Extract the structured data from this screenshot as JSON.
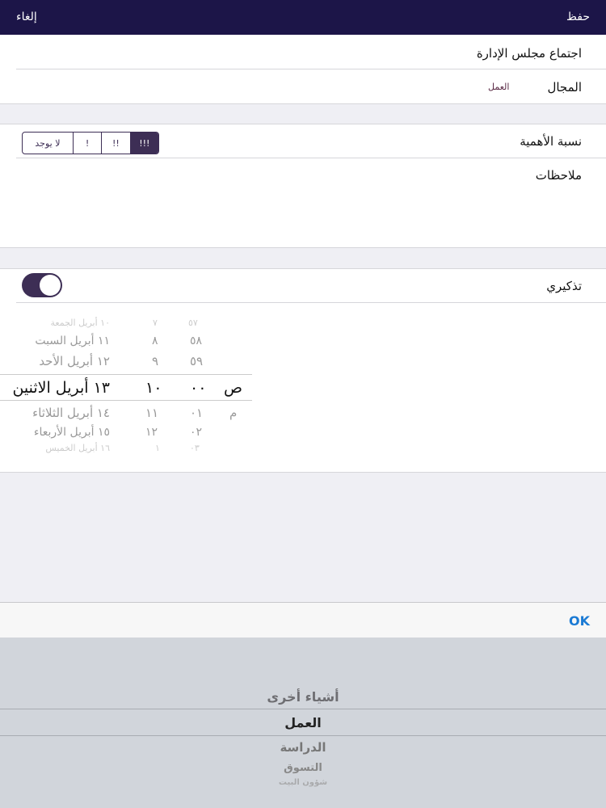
{
  "nav": {
    "save": "حفظ",
    "cancel": "إلغاء"
  },
  "form": {
    "title": "اجتماع مجلس الإدارة",
    "category_label": "المجال",
    "category_value": "العمل",
    "priority_label": "نسبة الأهمية",
    "priority_options": [
      "لا يوجد",
      "!",
      "!!",
      "!!!"
    ],
    "priority_selected": "!!!",
    "notes_label": "ملاحظات",
    "reminder_label": "تذكيري",
    "reminder_on": true
  },
  "date_picker": {
    "dates": [
      "١٠ أبريل الجمعة",
      "١١ أبريل السبت",
      "١٢ أبريل الأحد",
      "١٣ أبريل الاثنين",
      "١٤ أبريل الثلاثاء",
      "١٥ أبريل الأربعاء",
      "١٦ أبريل الخميس"
    ],
    "hours": [
      "٧",
      "٨",
      "٩",
      "١٠",
      "١١",
      "١٢",
      "١"
    ],
    "minutes": [
      "٥٧",
      "٥٨",
      "٥٩",
      "٠٠",
      "٠١",
      "٠٢",
      "٠٣"
    ],
    "ampm": [
      "ص",
      "م"
    ]
  },
  "toolbar": {
    "ok": "OK"
  },
  "category_picker": {
    "items": [
      "أشياء أخرى",
      "العمل",
      "الدراسة",
      "التسوق",
      "شؤون البيت"
    ],
    "selected": "العمل"
  },
  "colors": {
    "nav": "#1c1548",
    "accent": "#3d2e55",
    "ok": "#1a7ad4"
  }
}
